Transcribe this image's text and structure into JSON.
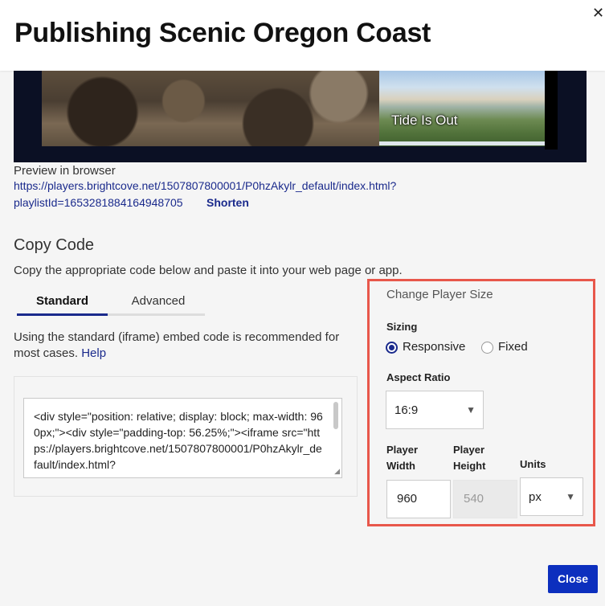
{
  "modal": {
    "title": "Publishing Scenic Oregon Coast",
    "close_icon": "close-icon"
  },
  "preview": {
    "slide_caption": "Tide Is Out",
    "label": "Preview in browser",
    "url_line1": "https://players.brightcove.net/1507807800001/P0hzAkylr_default/index.html?",
    "url_line2": "playlistId=1653281884164948705",
    "shorten_label": "Shorten"
  },
  "copy_code": {
    "title": "Copy Code",
    "instructions": "Copy the appropriate code below and paste it into your web page or app.",
    "tabs": [
      {
        "label": "Standard",
        "active": true
      },
      {
        "label": "Advanced",
        "active": false
      }
    ],
    "standard_desc": "Using the standard (iframe) embed code is recommended for most cases.",
    "help_link": "Help",
    "code": "<div style=\"position: relative; display: block; max-width: 960px;\"><div style=\"padding-top: 56.25%;\"><iframe src=\"https://players.brightcove.net/1507807800001/P0hzAkylr_default/index.html?"
  },
  "player_size": {
    "title": "Change Player Size",
    "sizing_label": "Sizing",
    "sizing_options": [
      {
        "label": "Responsive",
        "selected": true
      },
      {
        "label": "Fixed",
        "selected": false
      }
    ],
    "aspect_ratio_label": "Aspect Ratio",
    "aspect_ratio_value": "16:9",
    "width_label_1": "Player",
    "width_label_2": "Width",
    "height_label_1": "Player",
    "height_label_2": "Height",
    "units_label": "Units",
    "width_value": "960",
    "height_value": "540",
    "units_value": "px"
  },
  "footer": {
    "close_label": "Close"
  },
  "colors": {
    "accent": "#1a2a8c",
    "button": "#0c2fbe",
    "highlight_border": "#e8574b"
  }
}
